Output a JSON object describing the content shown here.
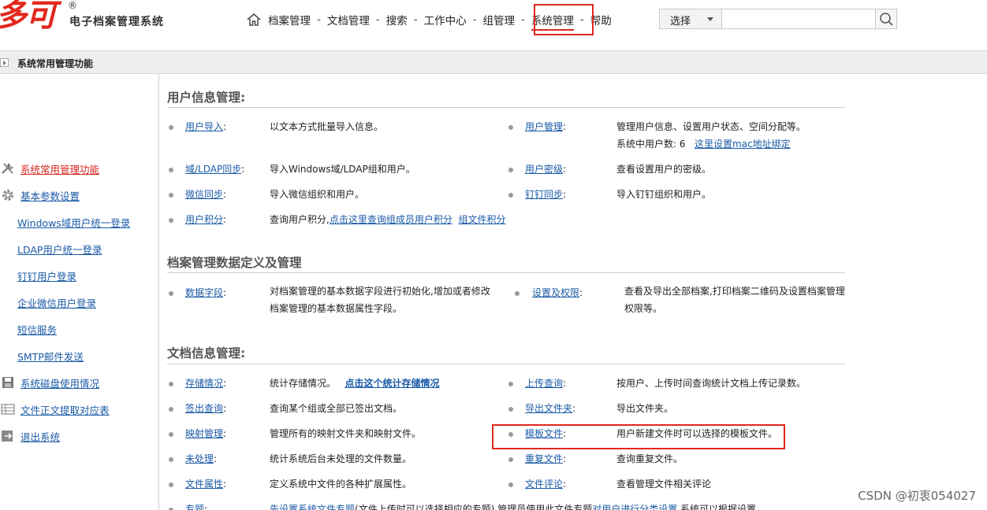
{
  "app": {
    "logo_text": "多可",
    "logo_reg": "®",
    "logo_sub": "电子档案管理系统"
  },
  "nav": {
    "items": [
      "档案管理",
      "文档管理",
      "搜索",
      "工作中心",
      "组管理",
      "系统管理",
      "帮助"
    ],
    "separator": "-",
    "active": "系统管理"
  },
  "search": {
    "select_label": "选择",
    "placeholder": ""
  },
  "section_bar": {
    "title": "系统常用管理功能"
  },
  "sidebar": {
    "items": [
      {
        "label": "系统常用管理功能",
        "icon": "tools-icon",
        "active": true
      },
      {
        "label": "基本参数设置",
        "icon": "gear-icon"
      },
      {
        "label": "Windows域用户统一登录"
      },
      {
        "label": "LDAP用户统一登录"
      },
      {
        "label": "钉钉用户登录"
      },
      {
        "label": "企业微信用户登录"
      },
      {
        "label": "短信服务"
      },
      {
        "label": "SMTP邮件发送"
      },
      {
        "label": "系统磁盘使用情况",
        "icon": "disk-icon"
      },
      {
        "label": "文件正文提取对应表",
        "icon": "table-icon"
      },
      {
        "label": "退出系统",
        "icon": "exit-icon"
      }
    ]
  },
  "groups": {
    "user": {
      "title": "用户信息管理:",
      "rows": [
        {
          "left_name": "用户导入",
          "left_desc": "以文本方式批量导入信息。",
          "right_name": "用户管理",
          "right_desc": "管理用户信息、设置用户状态、空间分配等。"
        },
        {
          "right_desc2_prefix": "系统中用户数:",
          "right_desc2_count": "6",
          "right_desc2_link": "这里设置mac地址绑定"
        },
        {
          "left_name": "域/LDAP同步",
          "left_desc": "导入Windows域/LDAP组和用户。",
          "right_name": "用户密级",
          "right_desc": "查看设置用户的密级。"
        },
        {
          "left_name": "微信同步",
          "left_desc": "导入微信组织和用户。",
          "right_name": "钉钉同步",
          "right_desc": "导入钉钉组织和用户。"
        },
        {
          "left_name": "用户积分",
          "left_desc": "查询用户积分,",
          "left_link1": "点击这里查询组成员用户积分",
          "left_link2": "组文件积分"
        }
      ]
    },
    "archive": {
      "title": "档案管理数据定义及管理",
      "rows": [
        {
          "left_name": "数据字段",
          "left_desc": "对档案管理的基本数据字段进行初始化,增加或者修改档案管理的基本数据属性字段。",
          "right_name": "设置及权限",
          "right_desc": "查看及导出全部档案,打印档案二维码及设置档案管理权限等。"
        }
      ]
    },
    "doc": {
      "title": "文档信息管理:",
      "rows": [
        {
          "left_name": "存储情况",
          "left_desc": "统计存储情况。",
          "left_link": "点击这个统计存储情况",
          "right_name": "上传查询",
          "right_desc": "按用户、上传时间查询统计文档上传记录数。"
        },
        {
          "left_name": "签出查询",
          "left_desc": "查询某个组或全部已签出文档。",
          "right_name": "导出文件夹",
          "right_desc": "导出文件夹。"
        },
        {
          "left_name": "映射管理",
          "left_desc": "管理所有的映射文件夹和映射文件。",
          "right_name": "模板文件",
          "right_desc": "用户新建文件时可以选择的模板文件。"
        },
        {
          "left_name": "未处理",
          "left_desc": "统计系统后台未处理的文件数量。",
          "right_name": "重复文件",
          "right_desc": "查询重复文件。"
        },
        {
          "left_name": "文件属性",
          "left_desc": "定义系统中文件的各种扩展属性。",
          "right_name": "文件评论",
          "right_desc": "查看管理文件相关评论"
        },
        {
          "left_name": "专题",
          "left_link": "先设置系统文件专题",
          "left_desc": "(文件上传时可以选择相应的专题),管理员使用此文件专题",
          "left_link2": "对用户进行分类设置",
          "left_desc2": ",系统可以根据设置"
        }
      ]
    }
  },
  "name_suffix": ":",
  "watermark": "CSDN @初衷054027",
  "colors": {
    "accent_red": "#e0281e",
    "link_blue": "#1a5aa6"
  }
}
